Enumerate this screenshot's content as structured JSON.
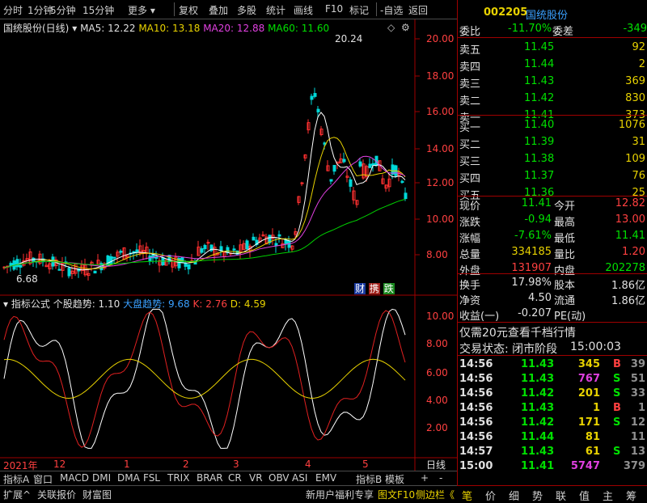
{
  "toolbar": {
    "items": [
      "分时",
      "1分钟",
      "5分钟",
      "15分钟",
      "更多",
      "复权",
      "叠加",
      "多股",
      "统计",
      "画线",
      "F10",
      "标记",
      "-自选",
      "返回"
    ]
  },
  "chart_header": {
    "name": "国统股份(日线)",
    "ma5": "MA5: 12.22",
    "ma10": "MA10: 13.18",
    "ma20": "MA20: 12.88",
    "ma60": "MA60: 11.60"
  },
  "price_axis": [
    "20.00",
    "18.00",
    "16.00",
    "14.00",
    "12.00",
    "10.00",
    "8.00"
  ],
  "peak_label": "20.24",
  "low_label": "6.68",
  "badges": [
    "财",
    "携",
    "跌"
  ],
  "indicator_header": {
    "name": "指标公式",
    "trend": "个股趋势: 1.10",
    "market": "大盘趋势: 9.68",
    "k": "K: 2.76",
    "d": "D: 4.59"
  },
  "ind_axis": [
    "10.00",
    "8.00",
    "6.00",
    "4.00",
    "2.00"
  ],
  "date_axis": [
    "2021年",
    "12",
    "1",
    "2",
    "3",
    "4",
    "5"
  ],
  "date_axis_right": "日线",
  "tabs": [
    "指标A",
    "窗口",
    "MACD",
    "DMI",
    "DMA",
    "FSL",
    "TRIX",
    "BRAR",
    "CR",
    "VR",
    "OBV",
    "ASI",
    "EMV",
    "指标B",
    "模板",
    "+",
    "-"
  ],
  "bottom": {
    "expand": "扩展^",
    "relation": "关联报价",
    "caifu": "财富图",
    "promo": "新用户福利专享",
    "f10": "图文F10",
    "side": "侧边栏《"
  },
  "stock": {
    "code": "002205",
    "name": "国统股份"
  },
  "weibi": {
    "label1": "委比",
    "val1": "-11.70%",
    "label2": "委差",
    "val2": "-349"
  },
  "sell": [
    {
      "l": "卖五",
      "p": "11.45",
      "v": "92"
    },
    {
      "l": "卖四",
      "p": "11.44",
      "v": "2"
    },
    {
      "l": "卖三",
      "p": "11.43",
      "v": "369"
    },
    {
      "l": "卖二",
      "p": "11.42",
      "v": "830"
    },
    {
      "l": "卖一",
      "p": "11.41",
      "v": "373"
    }
  ],
  "buy": [
    {
      "l": "买一",
      "p": "11.40",
      "v": "1076"
    },
    {
      "l": "买二",
      "p": "11.39",
      "v": "31"
    },
    {
      "l": "买三",
      "p": "11.38",
      "v": "109"
    },
    {
      "l": "买四",
      "p": "11.37",
      "v": "76"
    },
    {
      "l": "买五",
      "p": "11.36",
      "v": "25"
    }
  ],
  "quote": [
    {
      "l1": "现价",
      "v1": "11.41",
      "l2": "今开",
      "v2": "12.82"
    },
    {
      "l1": "涨跌",
      "v1": "-0.94",
      "l2": "最高",
      "v2": "13.00"
    },
    {
      "l1": "涨幅",
      "v1": "-7.61%",
      "l2": "最低",
      "v2": "11.41"
    },
    {
      "l1": "总量",
      "v1": "334185",
      "l2": "量比",
      "v2": "1.20"
    },
    {
      "l1": "外盘",
      "v1": "131907",
      "l2": "内盘",
      "v2": "202278"
    }
  ],
  "quote2": [
    {
      "l1": "换手",
      "v1": "17.98%",
      "l2": "股本",
      "v2": "1.86亿"
    },
    {
      "l1": "净资",
      "v1": "4.50",
      "l2": "流通",
      "v2": "1.86亿"
    },
    {
      "l1": "收益(一)",
      "v1": "-0.207",
      "l2": "PE(动)",
      "v2": ""
    }
  ],
  "promo_line": "仅需20元查看千档行情",
  "status": {
    "label": "交易状态: 闭市阶段",
    "time": "15:00:03"
  },
  "ticks": [
    {
      "t": "14:56",
      "p": "11.43",
      "v": "345",
      "s": "B",
      "n": "39"
    },
    {
      "t": "14:56",
      "p": "11.43",
      "v": "767",
      "s": "S",
      "n": "51"
    },
    {
      "t": "14:56",
      "p": "11.42",
      "v": "201",
      "s": "S",
      "n": "33"
    },
    {
      "t": "14:56",
      "p": "11.43",
      "v": "1",
      "s": "B",
      "n": "1"
    },
    {
      "t": "14:56",
      "p": "11.42",
      "v": "171",
      "s": "S",
      "n": "12"
    },
    {
      "t": "14:56",
      "p": "11.44",
      "v": "81",
      "s": "",
      "n": "11"
    },
    {
      "t": "14:57",
      "p": "11.43",
      "v": "61",
      "s": "S",
      "n": "13"
    },
    {
      "t": "15:00",
      "p": "11.41",
      "v": "5747",
      "s": "",
      "n": "379"
    }
  ],
  "rtabs": [
    "笔",
    "价",
    "细",
    "势",
    "联",
    "值",
    "主",
    "筹"
  ]
}
